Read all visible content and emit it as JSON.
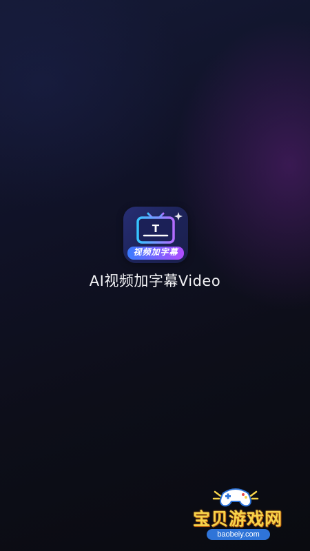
{
  "app": {
    "icon_label": "视频加字幕",
    "title": "AI视频加字幕Video",
    "icon_glyph": "T",
    "icon_name": "tv-subtitle-icon"
  },
  "watermark": {
    "main_text": "宝贝游戏网",
    "url": "baobeiy.com",
    "icon_name": "gamepad-mascot-icon"
  },
  "colors": {
    "background": "#0b0c14",
    "accent_purple": "#5c2078",
    "icon_bg": "#272e74",
    "tv_frame_start": "#35c4ff",
    "tv_frame_end": "#b46cff",
    "watermark_yellow": "#f6d34b",
    "watermark_blue": "#2f74d8"
  }
}
